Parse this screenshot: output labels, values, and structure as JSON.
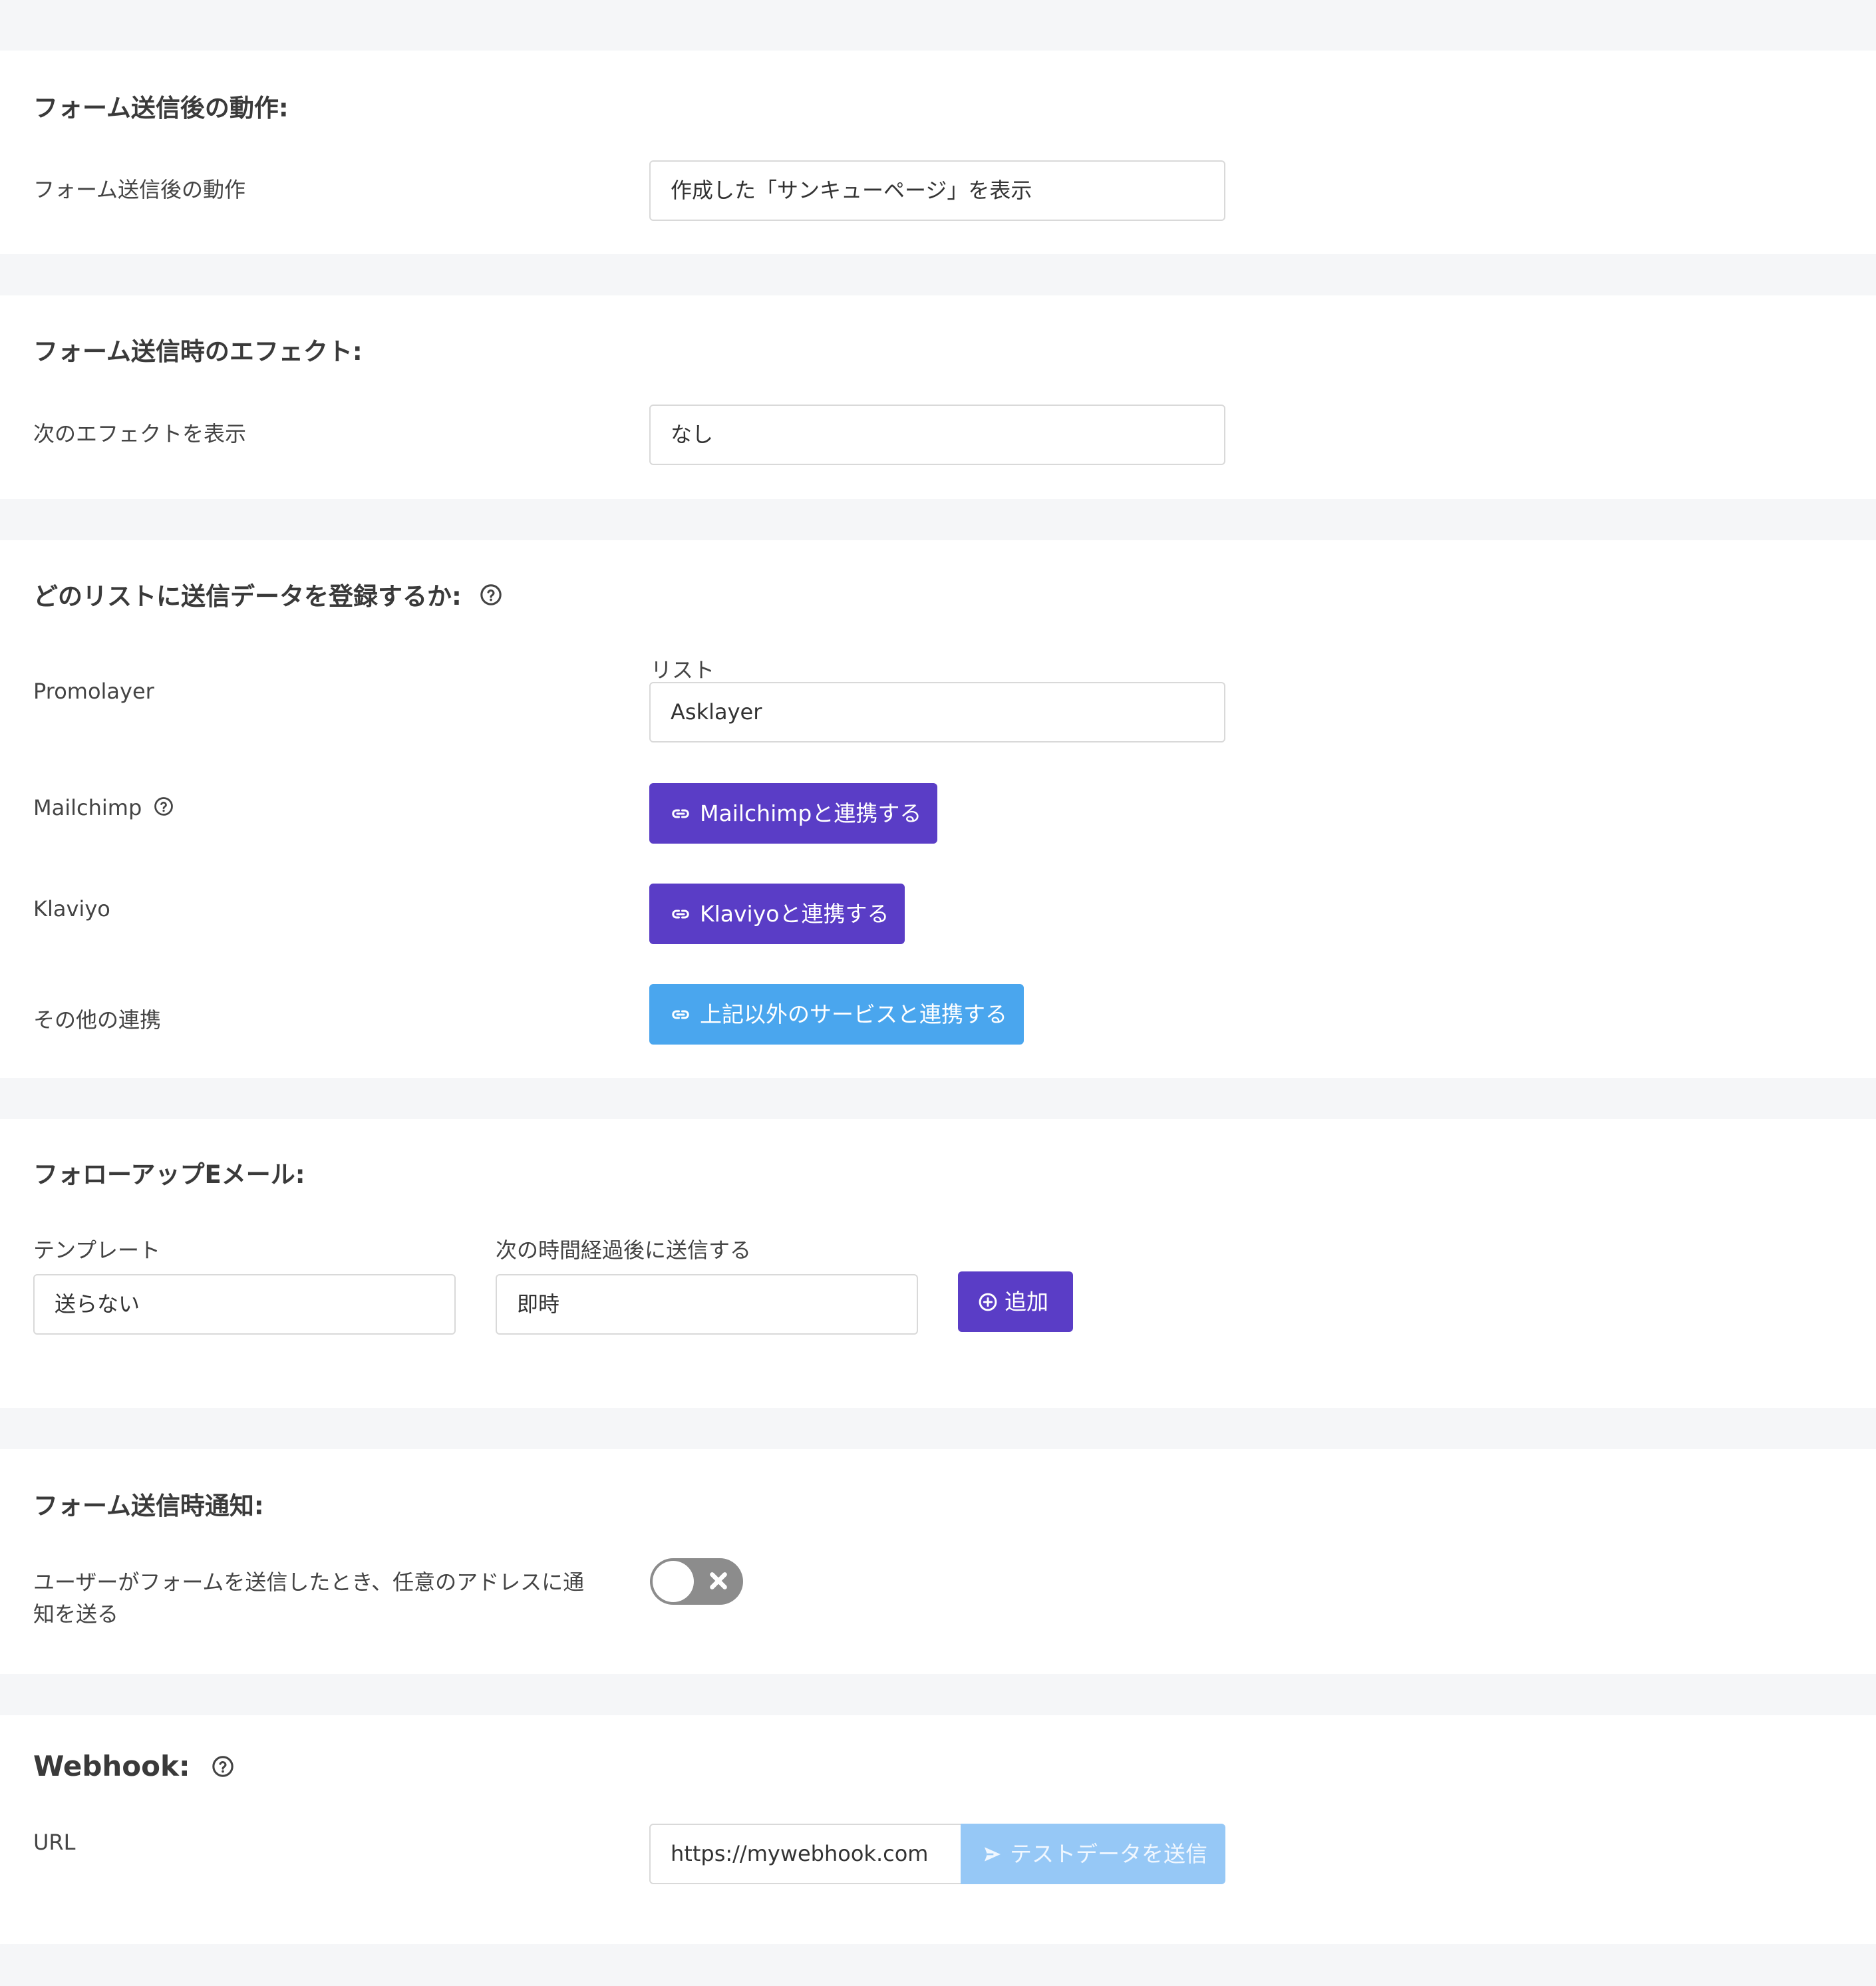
{
  "after_submit": {
    "title": "フォーム送信後の動作:",
    "label": "フォーム送信後の動作",
    "value": "作成した「サンキューページ」を表示"
  },
  "submit_effect": {
    "title": "フォーム送信時のエフェクト:",
    "label": "次のエフェクトを表示",
    "value": "なし"
  },
  "lists": {
    "title": "どのリストに送信データを登録するか:",
    "promolayer_label": "Promolayer",
    "list_caption": "リスト",
    "list_value": "Asklayer",
    "mailchimp_label": "Mailchimp",
    "mailchimp_button": "Mailchimpと連携する",
    "klaviyo_label": "Klaviyo",
    "klaviyo_button": "Klaviyoと連携する",
    "other_label": "その他の連携",
    "other_button": "上記以外のサービスと連携する"
  },
  "followup": {
    "title": "フォローアップEメール:",
    "template_label": "テンプレート",
    "template_value": "送らない",
    "delay_label": "次の時間経過後に送信する",
    "delay_value": "即時",
    "add_button": "追加"
  },
  "notification": {
    "title": "フォーム送信時通知:",
    "label_line1": "ユーザーがフォームを送信したとき、任意のアドレスに通",
    "label_line2": "知を送る",
    "toggle_on": false
  },
  "webhook": {
    "title": "Webhook:",
    "url_label": "URL",
    "url_value": "https://mywebhook.com",
    "test_button": "テストデータを送信"
  },
  "colors": {
    "purple": "#5a3dc6",
    "blue": "#4aa6ee",
    "light_blue": "#96c8f6",
    "toggle_off": "#8c8c8c"
  }
}
